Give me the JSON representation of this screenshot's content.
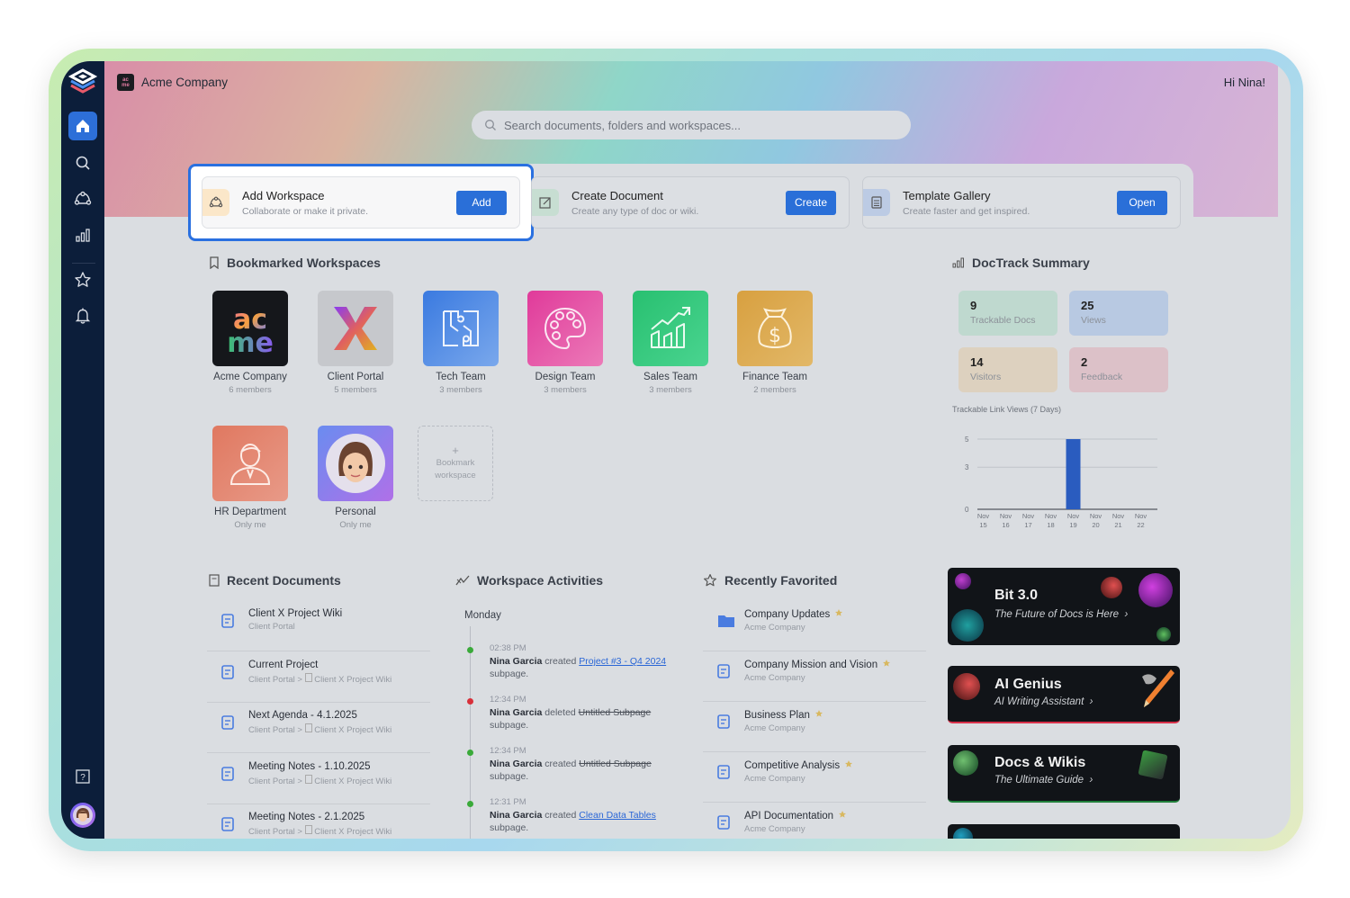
{
  "header": {
    "company": "Acme Company",
    "company_logo_text": "ac me",
    "greeting": "Hi Nina!",
    "search_placeholder": "Search documents, folders and workspaces..."
  },
  "sidebar": {
    "items": [
      {
        "name": "home",
        "icon": "home-icon",
        "active": true
      },
      {
        "name": "search",
        "icon": "search-icon"
      },
      {
        "name": "workspaces",
        "icon": "workspaces-icon"
      },
      {
        "name": "analytics",
        "icon": "bar-chart-icon"
      },
      {
        "name": "favorites",
        "icon": "star-icon"
      },
      {
        "name": "notifications",
        "icon": "bell-icon"
      },
      {
        "name": "help",
        "icon": "help-icon"
      }
    ]
  },
  "quick_actions": [
    {
      "title": "Add Workspace",
      "subtitle": "Collaborate or make it private.",
      "button": "Add",
      "icon": "workspace-icon",
      "color": "#fbe7c9"
    },
    {
      "title": "Create Document",
      "subtitle": "Create any type of doc or wiki.",
      "button": "Create",
      "icon": "edit-icon",
      "color": "#c7ded2"
    },
    {
      "title": "Template Gallery",
      "subtitle": "Create faster and get inspired.",
      "button": "Open",
      "icon": "template-icon",
      "color": "#bccbe4"
    }
  ],
  "bookmarked": {
    "title": "Bookmarked Workspaces",
    "items": [
      {
        "name": "Acme Company",
        "members": "6 members"
      },
      {
        "name": "Client Portal",
        "members": "5 members"
      },
      {
        "name": "Tech Team",
        "members": "3 members"
      },
      {
        "name": "Design Team",
        "members": "3 members"
      },
      {
        "name": "Sales Team",
        "members": "3 members"
      },
      {
        "name": "Finance Team",
        "members": "2 members"
      },
      {
        "name": "HR Department",
        "members": "Only me"
      },
      {
        "name": "Personal",
        "members": "Only me"
      }
    ],
    "add_plus": "+",
    "add_label": "Bookmark workspace"
  },
  "doctrack": {
    "title": "DocTrack Summary",
    "stats": [
      {
        "value": "9",
        "label": "Trackable Docs",
        "color": "#bfd9cf"
      },
      {
        "value": "25",
        "label": "Views",
        "color": "#b8c9e2"
      },
      {
        "value": "14",
        "label": "Visitors",
        "color": "#ddd1bf"
      },
      {
        "value": "2",
        "label": "Feedback",
        "color": "#dcc1c8"
      }
    ]
  },
  "chart_data": {
    "type": "bar",
    "title": "Trackable Link Views (7 Days)",
    "categories": [
      "Nov 15",
      "Nov 16",
      "Nov 17",
      "Nov 18",
      "Nov 19",
      "Nov 20",
      "Nov 21",
      "Nov 22"
    ],
    "values": [
      0,
      0,
      0,
      0,
      5,
      0,
      0,
      0
    ],
    "yticks": [
      0,
      3,
      5
    ],
    "ylim": [
      0,
      5
    ],
    "grid": true,
    "bar_color": "#2a5cbf"
  },
  "recent_documents": {
    "title": "Recent Documents",
    "items": [
      {
        "title": "Client X Project Wiki",
        "path": "Client Portal",
        "parent": ""
      },
      {
        "title": "Current Project",
        "path": "Client Portal >",
        "parent": "Client X Project Wiki"
      },
      {
        "title": "Next Agenda - 4.1.2025",
        "path": "Client Portal >",
        "parent": "Client X Project Wiki"
      },
      {
        "title": "Meeting Notes - 1.10.2025",
        "path": "Client Portal >",
        "parent": "Client X Project Wiki"
      },
      {
        "title": "Meeting Notes - 2.1.2025",
        "path": "Client Portal >",
        "parent": "Client X Project Wiki"
      }
    ]
  },
  "activities": {
    "title": "Workspace Activities",
    "day": "Monday",
    "items": [
      {
        "time": "02:38 PM",
        "user": "Nina Garcia",
        "verb": "created",
        "target": "Project #3 - Q4 2024",
        "suffix": "subpage.",
        "status": "created"
      },
      {
        "time": "12:34 PM",
        "user": "Nina Garcia",
        "verb": "deleted",
        "target": "Untitled Subpage",
        "suffix": "subpage.",
        "status": "deleted"
      },
      {
        "time": "12:34 PM",
        "user": "Nina Garcia",
        "verb": "created",
        "target": "Untitled Subpage",
        "suffix": "subpage.",
        "status": "created-struck"
      },
      {
        "time": "12:31 PM",
        "user": "Nina Garcia",
        "verb": "created",
        "target": "Clean Data Tables",
        "suffix": "subpage.",
        "status": "created"
      }
    ]
  },
  "favorites": {
    "title": "Recently Favorited",
    "items": [
      {
        "title": "Company Updates",
        "path": "Acme Company",
        "type": "folder"
      },
      {
        "title": "Company Mission and Vision",
        "path": "Acme Company",
        "type": "doc"
      },
      {
        "title": "Business Plan",
        "path": "Acme Company",
        "type": "doc"
      },
      {
        "title": "Competitive Analysis",
        "path": "Acme Company",
        "type": "doc"
      },
      {
        "title": "API Documentation",
        "path": "Acme Company",
        "type": "doc"
      }
    ]
  },
  "promos": [
    {
      "title": "Bit 3.0",
      "subtitle": "The Future of Docs is Here"
    },
    {
      "title": "AI Genius",
      "subtitle": "AI Writing Assistant"
    },
    {
      "title": "Docs & Wikis",
      "subtitle": "The Ultimate Guide"
    }
  ]
}
